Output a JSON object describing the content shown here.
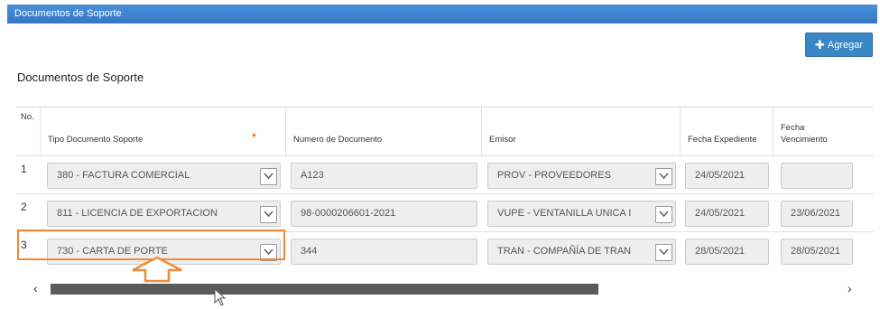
{
  "window": {
    "title": "Documentos de Soporte"
  },
  "toolbar": {
    "add_label": "Agregar",
    "add_icon": "plus-icon"
  },
  "section": {
    "title": "Documentos de Soporte"
  },
  "table": {
    "headers": {
      "no": "No.",
      "tipo": "Tipo Documento Soporte",
      "numero": "Numero de Documento",
      "emisor": "Emisor",
      "fecha_exp": "Fecha Expediente",
      "fecha_venc_1": "Fecha",
      "fecha_venc_2": "Vencimiento"
    },
    "required_marker": "•",
    "rows": [
      {
        "no": "1",
        "tipo": "380 - FACTURA COMERCIAL",
        "numero": "A123",
        "emisor": "PROV - PROVEEDORES",
        "fecha_exp": "24/05/2021",
        "fecha_venc": ""
      },
      {
        "no": "2",
        "tipo": "811 - LICENCIA DE EXPORTACION",
        "numero": "98-0000206601-2021",
        "emisor": "VUPE - VENTANILLA UNICA I",
        "fecha_exp": "24/05/2021",
        "fecha_venc": "23/06/2021"
      },
      {
        "no": "3",
        "tipo": "730 - CARTA DE PORTE",
        "numero": "344",
        "emisor": "TRAN - COMPAÑÍA DE TRAN",
        "fecha_exp": "28/05/2021",
        "fecha_venc": "28/05/2021"
      }
    ]
  },
  "scrollbar": {
    "left": "‹",
    "right": "›",
    "position_fraction": 0.0,
    "visible_fraction": 0.69
  },
  "colors": {
    "accent": "#3a87c8",
    "highlight": "#f08a3a"
  }
}
